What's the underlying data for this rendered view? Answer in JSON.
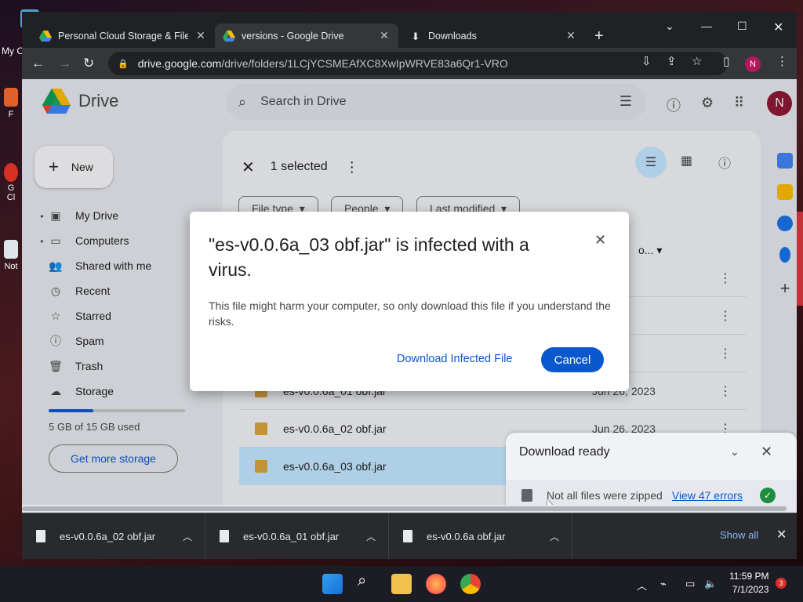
{
  "desktop": {
    "icons": [
      {
        "label": "My C",
        "icon": "computer-icon"
      },
      {
        "label": "F",
        "icon": "app-shortcut-icon"
      },
      {
        "label": "G",
        "icon": "chrome-shortcut-icon"
      },
      {
        "label": "Cl",
        "icon": "chrome-shortcut-icon"
      },
      {
        "label": "Not",
        "icon": "notepad-icon"
      }
    ]
  },
  "browser": {
    "tabs": [
      {
        "title": "Personal Cloud Storage & File Sh",
        "icon": "google-drive-favicon",
        "active": false
      },
      {
        "title": "versions - Google Drive",
        "icon": "google-drive-favicon",
        "active": true
      },
      {
        "title": "Downloads",
        "icon": "download-icon",
        "active": false
      }
    ],
    "url_host": "drive.google.com",
    "url_path": "/drive/folders/1LCjYCSMEAfXC8XwIpWRVE83a6Qr1-VRO",
    "profile_initial": "N"
  },
  "drive": {
    "logo_text": "Drive",
    "search_placeholder": "Search in Drive",
    "account_initial": "N",
    "new_label": "New",
    "nav": [
      {
        "label": "My Drive",
        "icon": "my-drive-icon",
        "expandable": true
      },
      {
        "label": "Computers",
        "icon": "computers-icon",
        "expandable": true
      },
      {
        "label": "Shared with me",
        "icon": "shared-icon",
        "expandable": false
      },
      {
        "label": "Recent",
        "icon": "clock-icon",
        "expandable": false
      },
      {
        "label": "Starred",
        "icon": "star-icon",
        "expandable": false
      },
      {
        "label": "Spam",
        "icon": "spam-icon",
        "expandable": false
      },
      {
        "label": "Trash",
        "icon": "trash-icon",
        "expandable": false
      },
      {
        "label": "Storage",
        "icon": "cloud-icon",
        "expandable": false
      }
    ],
    "storage": {
      "used_text": "5 GB of 15 GB used",
      "used_fraction": 0.33,
      "button": "Get more storage"
    },
    "selection": {
      "text": "1 selected"
    },
    "filters": [
      "File type",
      "People",
      "Last modified"
    ],
    "column_header": "o...",
    "files": [
      {
        "name": "",
        "date": "2023",
        "selected": false
      },
      {
        "name": "",
        "date": "2023",
        "selected": false
      },
      {
        "name": "",
        "date": "2023",
        "selected": false
      },
      {
        "name": "es-v0.0.6a_01 obf.jar",
        "date": "Jun 26, 2023",
        "selected": false
      },
      {
        "name": "es-v0.0.6a_02 obf.jar",
        "date": "Jun 26, 2023",
        "selected": false
      },
      {
        "name": "es-v0.0.6a_03 obf.jar",
        "date": "",
        "selected": true
      }
    ]
  },
  "dialog": {
    "title": "\"es-v0.0.6a_03 obf.jar\" is infected with a virus.",
    "body": "This file might harm your computer, so only download this file if you understand the risks.",
    "link": "Download Infected File",
    "button": "Cancel"
  },
  "download_panel": {
    "title": "Download ready",
    "message": "Not all files were zipped",
    "link": "View 47 errors"
  },
  "shelf": {
    "items": [
      "es-v0.0.6a_02 obf.jar",
      "es-v0.0.6a_01 obf.jar",
      "es-v0.0.6a obf.jar"
    ],
    "show_all": "Show all"
  },
  "taskbar": {
    "time": "11:59 PM",
    "date": "7/1/2023",
    "notifications": "3"
  },
  "colors": {
    "accent": "#0b57d0",
    "selected_row": "#c2e7ff",
    "browser_dark": "#202124"
  }
}
